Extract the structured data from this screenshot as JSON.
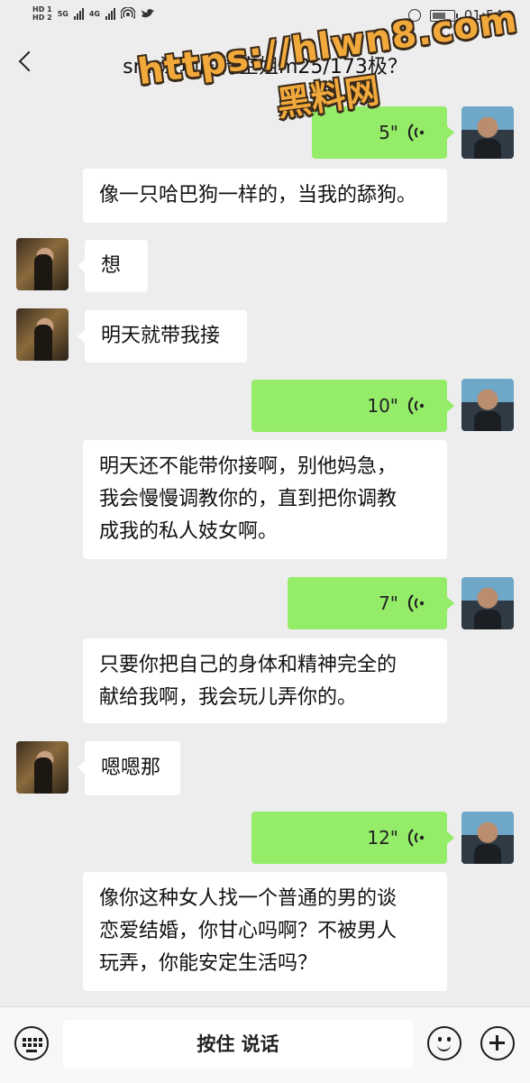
{
  "status_bar": {
    "network_hd1": "HD 1",
    "network_hd2": "HD 2",
    "network_5g": "5G",
    "network_4g": "4G",
    "battery_level": 0.7,
    "time": "01:54"
  },
  "header": {
    "back_icon": "chevron-left-icon",
    "title": "sm-深圳国行空姐m25/173极？"
  },
  "watermark": {
    "url": "https://hlwn8.com",
    "name": "黑料网"
  },
  "messages": [
    {
      "type": "voice",
      "from": "me",
      "duration": "5\""
    },
    {
      "type": "text",
      "from": "me",
      "lines": [
        "像一只哈巴狗一样的，当我的舔狗。"
      ]
    },
    {
      "type": "text",
      "from": "her",
      "lines": [
        "想"
      ]
    },
    {
      "type": "text",
      "from": "her",
      "lines": [
        "明天就带我接"
      ]
    },
    {
      "type": "voice",
      "from": "me",
      "duration": "10\""
    },
    {
      "type": "text",
      "from": "me",
      "lines": [
        "明天还不能带你接啊，别他妈急，",
        "我会慢慢调教你的，直到把你调教",
        "成我的私人妓女啊。"
      ]
    },
    {
      "type": "voice",
      "from": "me",
      "duration": "7\""
    },
    {
      "type": "text",
      "from": "me",
      "lines": [
        "只要你把自己的身体和精神完全的",
        "献给我啊，我会玩儿弄你的。"
      ]
    },
    {
      "type": "text",
      "from": "her",
      "lines": [
        "嗯嗯那"
      ]
    },
    {
      "type": "voice",
      "from": "me",
      "duration": "12\""
    },
    {
      "type": "text",
      "from": "me",
      "lines": [
        "像你这种女人找一个普通的男的谈",
        "恋爱结婚，你甘心吗啊？不被男人",
        "玩弄，你能安定生活吗？"
      ]
    }
  ],
  "input_bar": {
    "keyboard_icon": "keyboard-icon",
    "hold_to_talk_label": "按住 说话",
    "emoji_icon": "emoji-icon",
    "plus_icon": "plus-icon"
  },
  "colors": {
    "background": "#ededed",
    "voice_bubble": "#95ec69",
    "text_bubble": "#ffffff",
    "watermark": "#f2a93b"
  }
}
